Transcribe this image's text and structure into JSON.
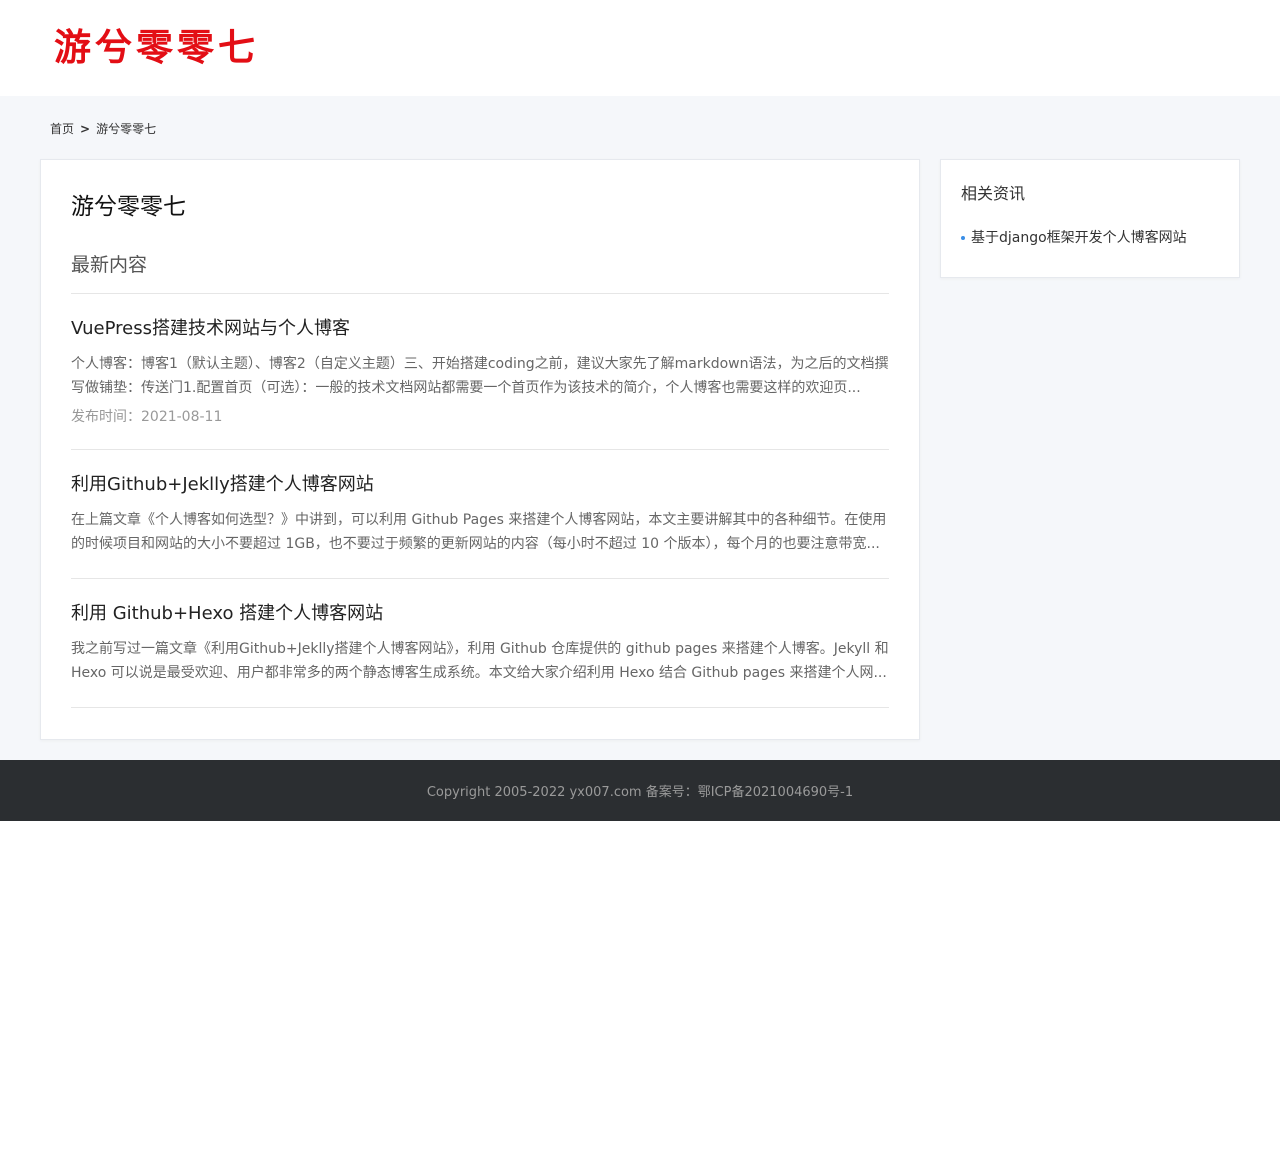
{
  "header": {
    "logo_text": "游兮零零七"
  },
  "breadcrumb": {
    "home": "首页",
    "separator": ">",
    "current": "游兮零零七"
  },
  "main": {
    "title": "游兮零零七",
    "section_title": "最新内容",
    "posts": [
      {
        "title": "VuePress搭建技术网站与个人博客",
        "excerpt": "个人博客：博客1（默认主题）、博客2（自定义主题）三、开始搭建coding之前，建议大家先了解markdown语法，为之后的文档撰写做铺垫：传送门1.配置首页（可选）：一般的技术文档网站都需要一个首页作为该技术的简介，个人博客也需要这样的欢迎页...",
        "date": "发布时间：2021-08-11"
      },
      {
        "title": "利用Github+Jeklly搭建个人博客网站",
        "excerpt": "在上篇文章《个人博客如何选型？》中讲到，可以利用 Github Pages 来搭建个人博客网站，本文主要讲解其中的各种细节。在使用的时候项目和网站的大小不要超过 1GB，也不要过于频繁的更新网站的内容（每小时不超过 10 个版本），每个月的也要注意带宽..."
      },
      {
        "title": "利用 Github+Hexo 搭建个人博客网站",
        "excerpt": "我之前写过一篇文章《利用Github+Jeklly搭建个人博客网站》，利用 Github 仓库提供的 github pages 来搭建个人博客。Jekyll 和 Hexo 可以说是最受欢迎、用户都非常多的两个静态博客生成系统。本文给大家介绍利用 Hexo 结合 Github pages 来搭建个人网..."
      }
    ]
  },
  "sidebar": {
    "title": "相关资讯",
    "items": [
      {
        "label": "基于django框架开发个人博客网站"
      }
    ]
  },
  "footer": {
    "copyright": "Copyright 2005-2022 yx007.com 备案号：鄂ICP备2021004690号-1"
  },
  "colors": {
    "logo": "#e30e15",
    "bullet": "#3a8ee6",
    "footer_bg": "#2b2e31",
    "main_bg": "#f5f7fa"
  }
}
